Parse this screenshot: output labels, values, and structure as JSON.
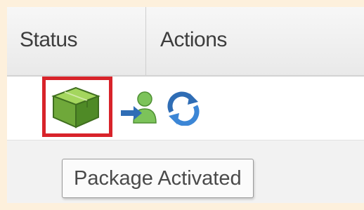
{
  "grid": {
    "columns": {
      "status": "Status",
      "actions": "Actions"
    },
    "row": {
      "status_icon": "package-activated-icon",
      "action_icons": [
        "assign-user-icon",
        "refresh-icon"
      ]
    }
  },
  "tooltip": {
    "text": "Package Activated"
  },
  "colors": {
    "highlight": "#d8232a",
    "package_green": "#7cb342",
    "user_green": "#6aa84f",
    "arrow_blue": "#2f6db5"
  }
}
